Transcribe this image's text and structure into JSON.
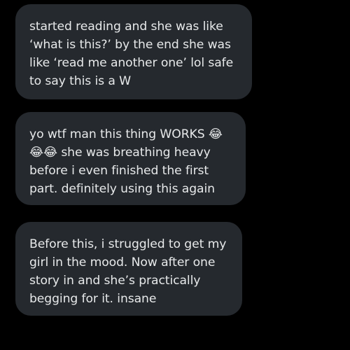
{
  "messages": [
    {
      "lines": [
        "started reading and she was like",
        "‘what is this?’ by the end she was",
        "like ‘read me another one’ lol safe",
        "to say this is a W"
      ]
    },
    {
      "lines": [
        "yo wtf man this thing WORKS 😂",
        "😂😂 she was breathing heavy",
        "before i even finished the first",
        "part. definitely using this again"
      ]
    },
    {
      "lines": [
        "Before this, i struggled to get my",
        "girl in the mood. Now after one",
        "story in and she’s practically",
        "begging for it. insane"
      ]
    }
  ],
  "colors": {
    "background": "#000000",
    "bubble": "#25292e",
    "text": "#e7e9ea"
  }
}
